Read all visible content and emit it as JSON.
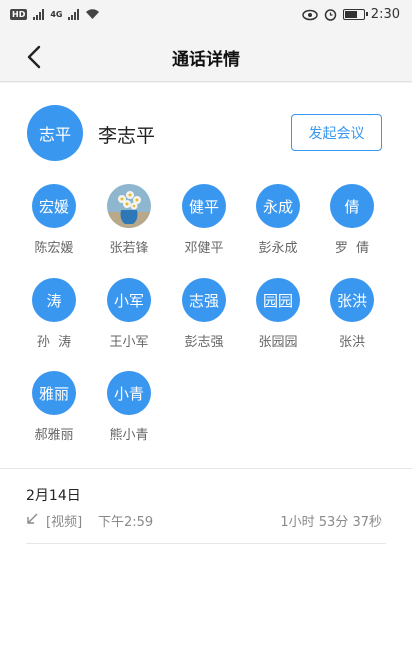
{
  "status_bar": {
    "hd_badge": "HD",
    "network_label": "4G",
    "time": "2:30",
    "icons": [
      "hd-icon",
      "signal-icon",
      "wifi-icon",
      "eye-icon",
      "alarm-icon",
      "battery-icon"
    ],
    "battery_level": 0.6
  },
  "header": {
    "title": "通话详情",
    "back_icon": "chevron-left-icon"
  },
  "contact": {
    "avatar_text": "志平",
    "name": "李志平",
    "meeting_button": "发起会议"
  },
  "members": [
    {
      "avatar": "宏媛",
      "name": "陈宏媛",
      "photo": false
    },
    {
      "avatar": "",
      "name": "张若锋",
      "photo": true
    },
    {
      "avatar": "健平",
      "name": "邓健平",
      "photo": false
    },
    {
      "avatar": "永成",
      "name": "彭永成",
      "photo": false
    },
    {
      "avatar": "倩",
      "name": "罗  倩",
      "photo": false
    },
    {
      "avatar": "涛",
      "name": "孙  涛",
      "photo": false
    },
    {
      "avatar": "小军",
      "name": "王小军",
      "photo": false
    },
    {
      "avatar": "志强",
      "name": "彭志强",
      "photo": false
    },
    {
      "avatar": "园园",
      "name": "张园园",
      "photo": false
    },
    {
      "avatar": "张洪",
      "name": "张洪",
      "photo": false
    },
    {
      "avatar": "雅丽",
      "name": "郝雅丽",
      "photo": false
    },
    {
      "avatar": "小青",
      "name": "熊小青",
      "photo": false
    }
  ],
  "call_log": {
    "date": "2月14日",
    "direction_icon": "incoming-arrow-icon",
    "type": "[视频]",
    "time": "下午2:59",
    "duration": "1小时 53分 37秒"
  },
  "colors": {
    "accent": "#3a97ef",
    "background": "#f4f4f4",
    "surface": "#ffffff",
    "muted_text": "#8a8a8a"
  }
}
